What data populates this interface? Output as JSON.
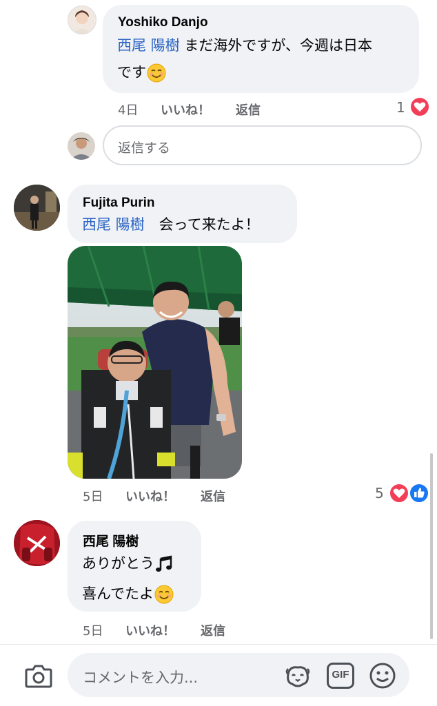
{
  "comments": [
    {
      "author": "Yoshiko Danjo",
      "mention": "西尾 陽樹",
      "line1_rest": " まだ海外ですが、今週は日本",
      "line2": "です",
      "time": "4日",
      "like": "いいね！",
      "reply": "返信",
      "reaction_count": "1"
    },
    {
      "author": "Fujita Purin",
      "mention": "西尾 陽樹",
      "text_rest": "　会って来たよ！",
      "time": "5日",
      "like": "いいね！",
      "reply": "返信",
      "reaction_count": "5"
    },
    {
      "author": "西尾 陽樹",
      "line1": "ありがとう",
      "line2": "喜んでたよ",
      "time": "5日",
      "like": "いいね！",
      "reply": "返信"
    }
  ],
  "reply_placeholder": "返信する",
  "comment_placeholder": "コメントを入力...",
  "gif_label": "GIF",
  "colors": {
    "mention": "#2b64c5",
    "love": "#f33e58",
    "like": "#1877f2",
    "bubble": "#f0f2f5"
  },
  "icons": [
    "camera-icon",
    "avatar-sticker-icon",
    "gif-icon",
    "emoji-icon",
    "love-reaction-icon",
    "like-reaction-icon",
    "music-note-icon"
  ]
}
